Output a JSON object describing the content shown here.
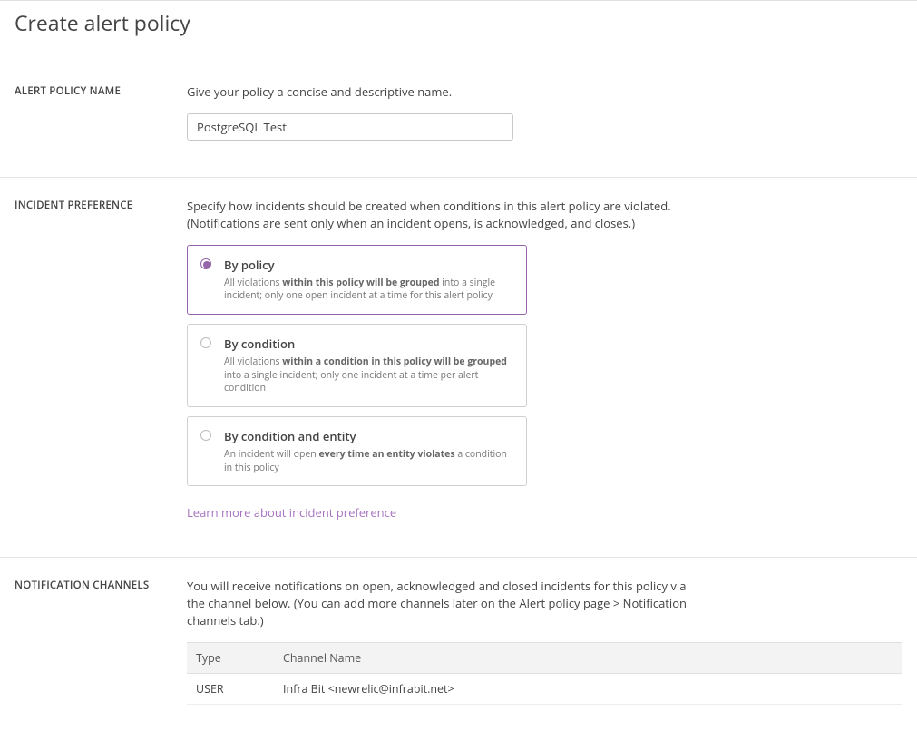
{
  "header": {
    "title": "Create alert policy"
  },
  "policy_name": {
    "label": "ALERT POLICY NAME",
    "hint": "Give your policy a concise and descriptive name.",
    "value": "PostgreSQL Test"
  },
  "incident_pref": {
    "label": "INCIDENT PREFERENCE",
    "hint": "Specify how incidents should be created when conditions in this alert policy are violated. (Notifications are sent only when an incident opens, is acknowledged, and closes.)",
    "options": {
      "by_policy": {
        "title": "By policy",
        "desc_pre": "All violations ",
        "desc_bold": "within this policy will be grouped",
        "desc_post": " into a single incident; only one open incident at a time for this alert policy"
      },
      "by_condition": {
        "title": "By condition",
        "desc_pre": "All violations ",
        "desc_bold": "within a condition in this policy will be grouped",
        "desc_post": " into a single incident; only one incident at a time per alert condition"
      },
      "by_condition_entity": {
        "title": "By condition and entity",
        "desc_pre": "An incident will open ",
        "desc_bold": "every time an entity violates",
        "desc_post": " a condition in this policy"
      }
    },
    "learn_more": "Learn more about incident preference"
  },
  "channels": {
    "label": "NOTIFICATION CHANNELS",
    "hint": "You will receive notifications on open, acknowledged and closed incidents for this policy via the channel below. (You can add more channels later on the Alert policy page > Notification channels tab.)",
    "columns": {
      "type": "Type",
      "name": "Channel Name"
    },
    "rows": [
      {
        "type": "USER",
        "name": "Infra Bit <newrelic@infrabit.net>"
      }
    ]
  }
}
